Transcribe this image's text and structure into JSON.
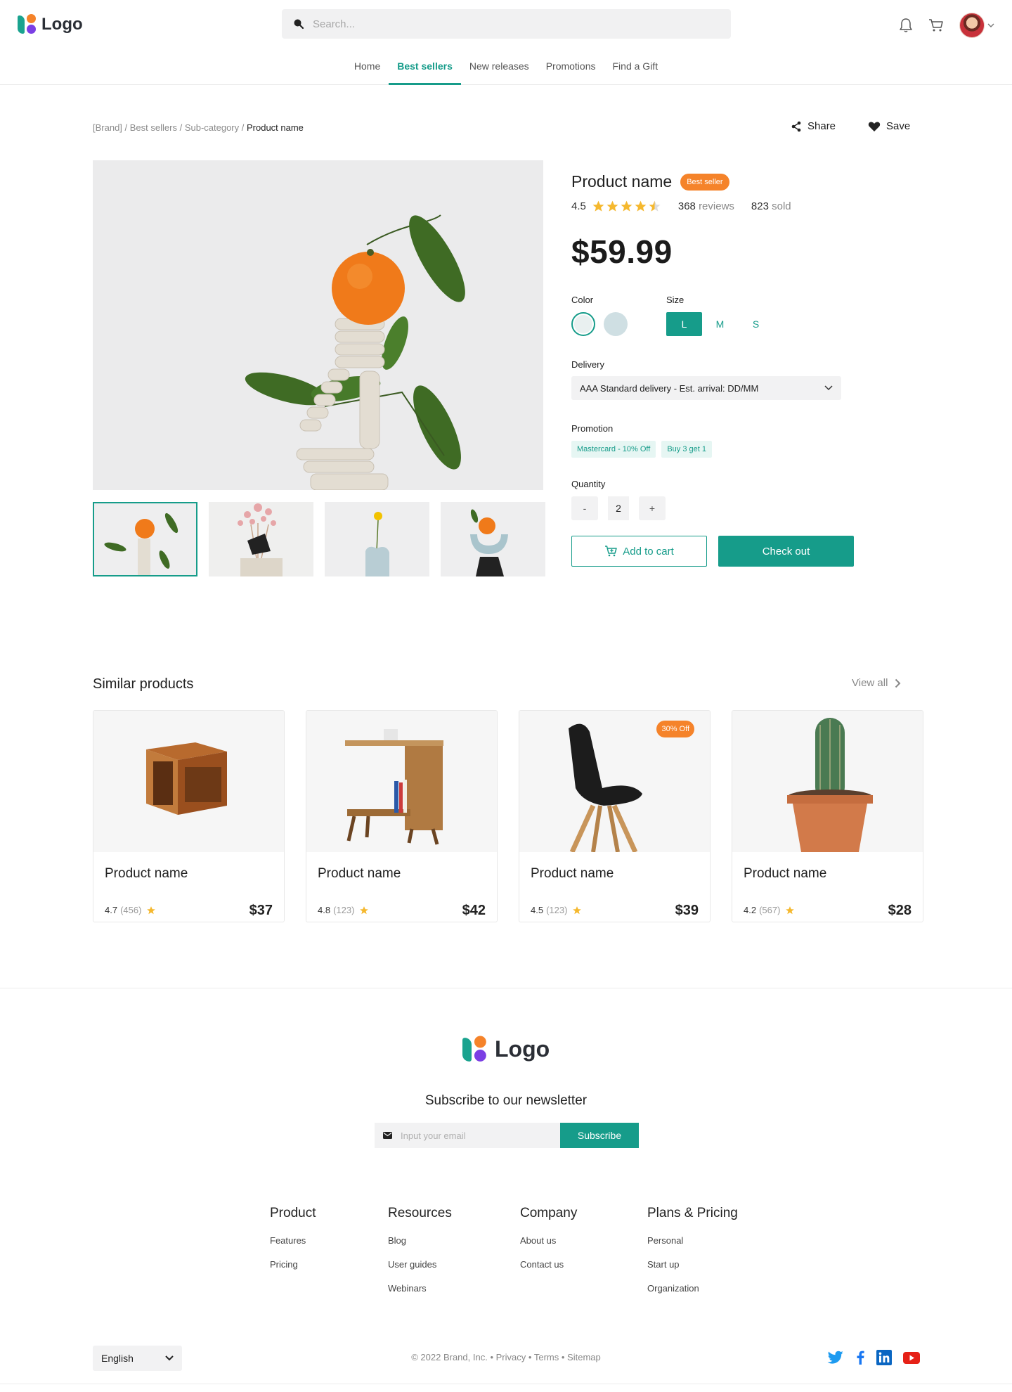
{
  "header": {
    "logo_text": "Logo",
    "search_placeholder": "Search...",
    "nav": [
      {
        "label": "Home",
        "active": false
      },
      {
        "label": "Best sellers",
        "active": true
      },
      {
        "label": "New releases",
        "active": false
      },
      {
        "label": "Promotions",
        "active": false
      },
      {
        "label": "Find a Gift",
        "active": false
      }
    ]
  },
  "breadcrumb": {
    "items": [
      "[Brand]",
      "Best sellers",
      "Sub-category"
    ],
    "separator": " / ",
    "current": "Product name"
  },
  "page_actions": {
    "share_label": "Share",
    "save_label": "Save"
  },
  "product": {
    "name": "Product name",
    "badge": "Best seller",
    "rating": "4.5",
    "stars_value": 4.5,
    "reviews_count": "368",
    "reviews_label": "reviews",
    "sold_count": "823",
    "sold_label": "sold",
    "price": "$59.99",
    "color_label": "Color",
    "size_label": "Size",
    "colors": [
      "#e9f0f0",
      "#cfdfe3"
    ],
    "sizes": [
      {
        "label": "L",
        "active": true
      },
      {
        "label": "M",
        "active": false
      },
      {
        "label": "S",
        "active": false
      }
    ],
    "delivery_label": "Delivery",
    "delivery_value": "AAA Standard delivery - Est. arrival: DD/MM",
    "promotion_label": "Promotion",
    "promotions": [
      "Mastercard - 10% Off",
      "Buy 3 get 1"
    ],
    "quantity_label": "Quantity",
    "quantity_minus": "-",
    "quantity": "2",
    "quantity_plus": "+",
    "add_to_cart_label": "Add to cart",
    "checkout_label": "Check out"
  },
  "similar": {
    "title": "Similar products",
    "view_all": "View all",
    "items": [
      {
        "name": "Product name",
        "rating": "4.7",
        "count": "(456)",
        "price": "$37",
        "badge": ""
      },
      {
        "name": "Product name",
        "rating": "4.8",
        "count": "(123)",
        "price": "$42",
        "badge": ""
      },
      {
        "name": "Product name",
        "rating": "4.5",
        "count": "(123)",
        "price": "$39",
        "badge": "30% Off"
      },
      {
        "name": "Product name",
        "rating": "4.2",
        "count": "(567)",
        "price": "$28",
        "badge": ""
      }
    ]
  },
  "footer": {
    "logo_text": "Logo",
    "newsletter_title": "Subscribe to our newsletter",
    "email_placeholder": "Input your email",
    "subscribe_label": "Subscribe",
    "columns": [
      {
        "title": "Product",
        "links": [
          "Features",
          "Pricing"
        ]
      },
      {
        "title": "Resources",
        "links": [
          "Blog",
          "User guides",
          "Webinars"
        ]
      },
      {
        "title": "Company",
        "links": [
          "About us",
          "Contact us"
        ]
      },
      {
        "title": "Plans & Pricing",
        "links": [
          "Personal",
          "Start up",
          "Organization"
        ]
      }
    ],
    "language": "English",
    "copyright": "© 2022 Brand, Inc.",
    "legal_links": [
      "Privacy",
      "Terms",
      "Sitemap"
    ],
    "bullet": "•",
    "socials": [
      "twitter-icon",
      "facebook-icon",
      "linkedin-icon",
      "youtube-icon"
    ]
  },
  "colors": {
    "accent": "#169c8a",
    "badge": "#f5832a",
    "star": "#f5b82e"
  }
}
